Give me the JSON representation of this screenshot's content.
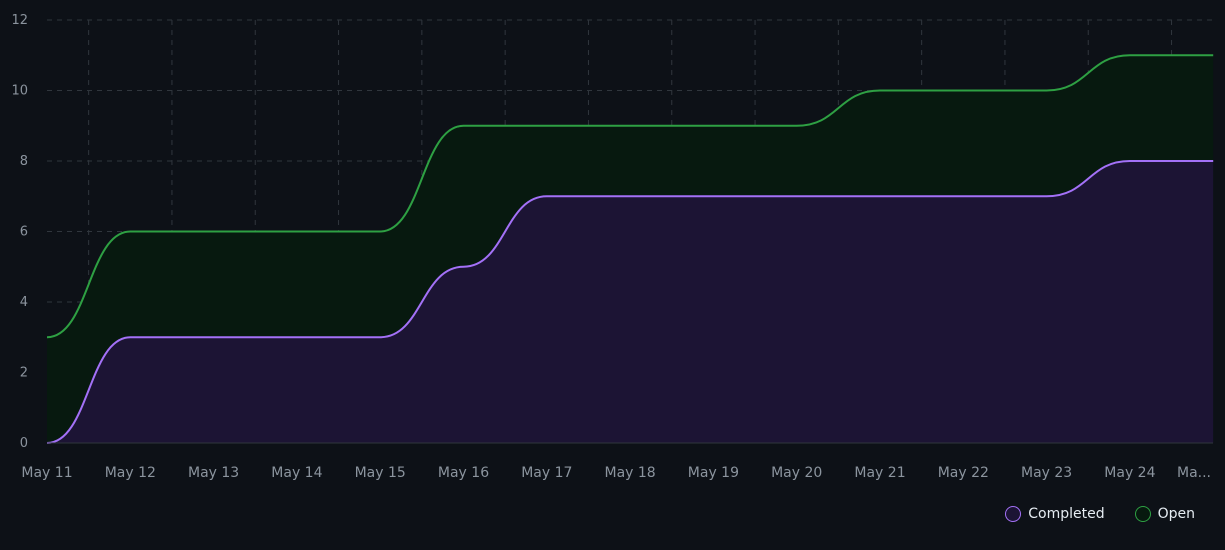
{
  "chart_data": {
    "type": "area",
    "categories": [
      "May 11",
      "May 12",
      "May 13",
      "May 14",
      "May 15",
      "May 16",
      "May 17",
      "May 18",
      "May 19",
      "May 20",
      "May 21",
      "May 22",
      "May 23",
      "May 24",
      "Ma..."
    ],
    "series": [
      {
        "name": "Completed",
        "color": "#a371f7",
        "fill": "#1c1434",
        "points": [
          [
            0,
            0
          ],
          [
            1,
            3
          ],
          [
            2,
            3
          ],
          [
            3,
            3
          ],
          [
            4,
            3
          ],
          [
            5,
            5
          ],
          [
            6,
            7
          ],
          [
            7,
            7
          ],
          [
            8,
            7
          ],
          [
            9,
            7
          ],
          [
            10,
            7
          ],
          [
            11,
            7
          ],
          [
            12,
            7
          ],
          [
            13,
            8
          ],
          [
            14,
            8
          ]
        ]
      },
      {
        "name": "Open",
        "color": "#2ea043",
        "fill": "#07190f",
        "points": [
          [
            0,
            3
          ],
          [
            1,
            6
          ],
          [
            2,
            6
          ],
          [
            3,
            6
          ],
          [
            4,
            6
          ],
          [
            5,
            9
          ],
          [
            6,
            9
          ],
          [
            7,
            9
          ],
          [
            8,
            9
          ],
          [
            9,
            9
          ],
          [
            10,
            10
          ],
          [
            11,
            10
          ],
          [
            12,
            10
          ],
          [
            13,
            11
          ],
          [
            14,
            11
          ]
        ]
      }
    ],
    "yticks": [
      0,
      2,
      4,
      6,
      8,
      10,
      12
    ],
    "ylim": [
      0,
      12
    ],
    "grid": true,
    "legend_position": "bottom-right"
  }
}
